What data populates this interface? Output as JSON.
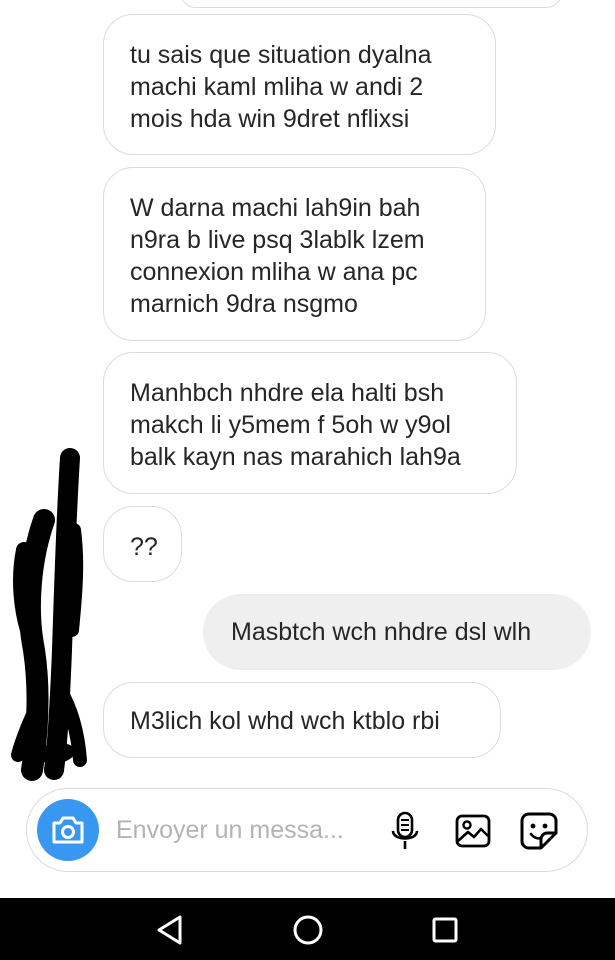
{
  "messages": [
    {
      "direction": "incoming",
      "text": "tu sais que situation dyalna\nmachi kaml mliha w andi 2\nmois hda win 9dret nflixsi"
    },
    {
      "direction": "incoming",
      "text": "W darna machi lah9in bah\nn9ra b live psq 3lablk lzem\nconnexion mliha w ana pc\nmarnich 9dra nsgmo"
    },
    {
      "direction": "incoming",
      "text": "Manhbch nhdre ela halti bsh\nmakch li y5mem f 5oh w y9ol\nbalk kayn nas marahich lah9a"
    },
    {
      "direction": "incoming",
      "text": "??"
    },
    {
      "direction": "outgoing",
      "text": "Masbtch wch nhdre dsl wlh"
    },
    {
      "direction": "incoming",
      "text": "M3lich kol whd wch ktblo rbi"
    }
  ],
  "composer": {
    "placeholder": "Envoyer un messa...",
    "camera_icon": "camera-icon",
    "mic_icon": "microphone-icon",
    "gallery_icon": "image-icon",
    "sticker_icon": "sticker-icon"
  },
  "navbar": {
    "back_icon": "back-triangle-icon",
    "home_icon": "home-circle-icon",
    "recent_icon": "recent-apps-square-icon"
  },
  "colors": {
    "accent": "#3897f0",
    "outgoing_bubble": "#efefef",
    "bubble_border": "#dcdcdc",
    "text": "#262626",
    "placeholder": "#b3b3b3"
  }
}
